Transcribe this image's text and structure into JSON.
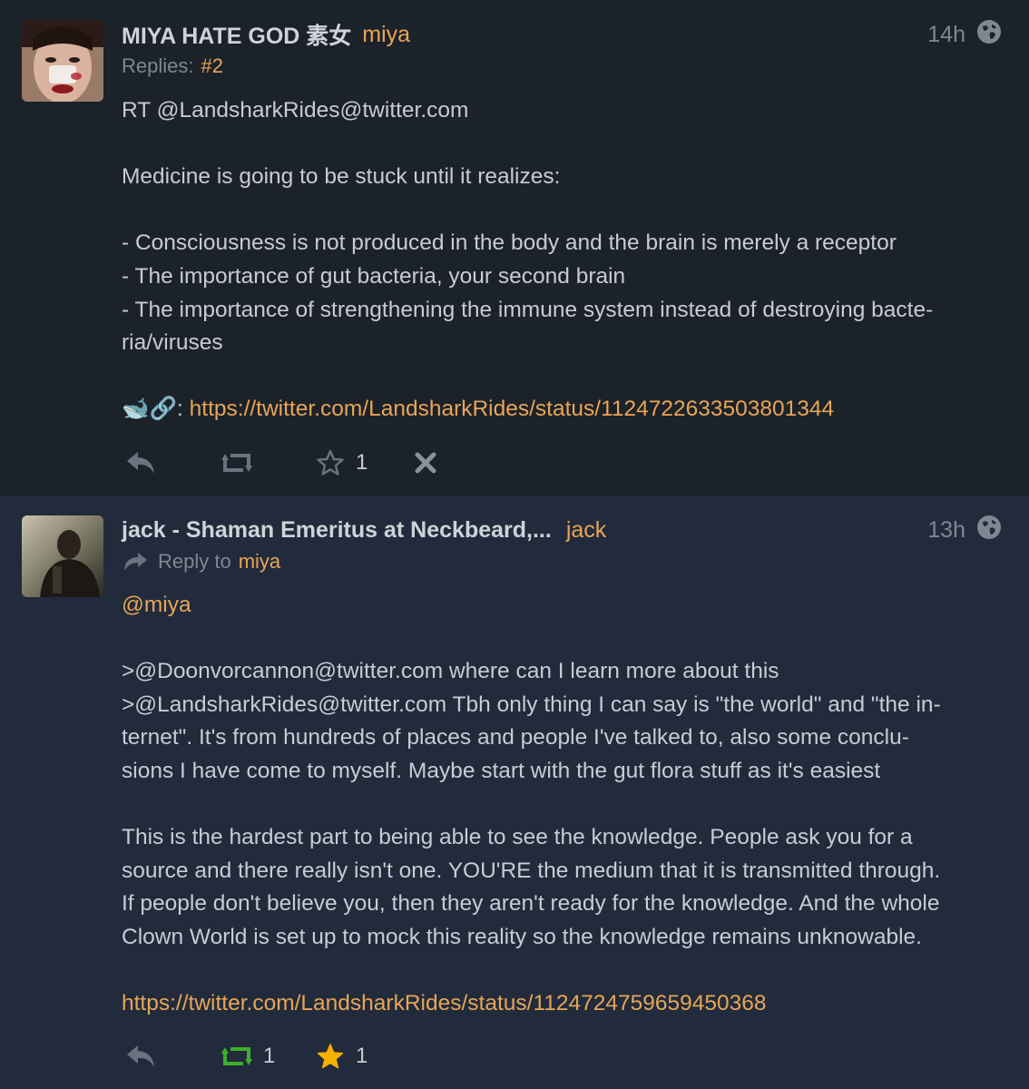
{
  "posts": [
    {
      "display_name": "MIYA HATE GOD 素女",
      "handle": "miya",
      "time": "14h",
      "replies_label": "Replies:",
      "replies_link": "#2",
      "body_lines": [
        "RT @LandsharkRides@twitter.com",
        "",
        "Medicine is going to be stuck until it realizes:",
        "",
        "- Consciousness is not produced in the body and the brain is merely a receptor",
        "- The importance of gut bacteria, your second brain",
        "- The importance of strengthening the immune system instead of destroying bacte-",
        "ria/viruses",
        ""
      ],
      "link_prefix": "🐋🔗:",
      "link": "https://twitter.com/LandsharkRides/status/1124722633503801344",
      "actions": {
        "favorite_count": "1"
      },
      "icons": [
        "reply-icon",
        "repeat-icon",
        "star-outline-icon",
        "delete-icon"
      ]
    },
    {
      "display_name": "jack - Shaman Emeritus at Neckbeard,...",
      "handle": "jack",
      "time": "13h",
      "reply_to_label": "Reply to",
      "reply_to_user": "miya",
      "mention": "@miya",
      "body_lines": [
        "",
        ">@Doonvorcannon@twitter.com where can I learn more about this",
        ">@LandsharkRides@twitter.com Tbh only thing I can say is \"the world\" and \"the in-",
        "ternet\". It's from hundreds of places and people I've talked to, also some conclu-",
        "sions I have come to myself. Maybe start with the gut flora stuff as it's easiest",
        "",
        "This is the hardest part to being able to see the knowledge. People ask you for a",
        "source and there really isn't one. YOU'RE the medium that it is transmitted through.",
        "If people don't believe you, then they aren't ready for the knowledge. And the whole",
        "Clown World is set up to mock this reality so the knowledge remains unknowable.",
        ""
      ],
      "link": "https://twitter.com/LandsharkRides/status/1124724759659450368",
      "actions": {
        "repeat_count": "1",
        "favorite_count": "1"
      },
      "icons": [
        "reply-icon",
        "repeat-icon",
        "star-filled-icon"
      ]
    }
  ],
  "colors": {
    "accent": "#e8a556",
    "repeat_active": "#3fae2a",
    "star_active": "#f5b000"
  }
}
